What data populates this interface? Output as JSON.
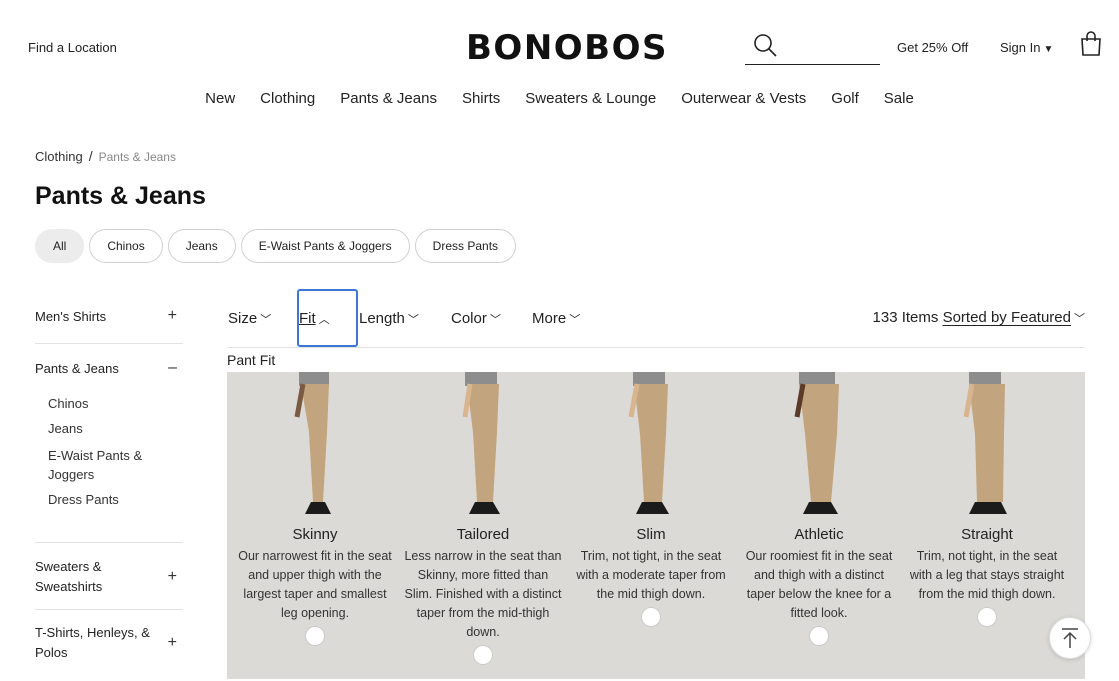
{
  "header": {
    "find_location": "Find a Location",
    "logo": "BONOBOS",
    "search_placeholder": "",
    "promo": "Get 25% Off",
    "sign_in": "Sign In",
    "icons": [
      "search-icon",
      "caret-down-icon",
      "bag-icon"
    ]
  },
  "nav": [
    "New",
    "Clothing",
    "Pants & Jeans",
    "Shirts",
    "Sweaters & Lounge",
    "Outerwear & Vests",
    "Golf",
    "Sale"
  ],
  "breadcrumb": {
    "parent": "Clothing",
    "separator": "/",
    "current": "Pants & Jeans"
  },
  "page_title": "Pants & Jeans",
  "chips": [
    {
      "label": "All",
      "active": true
    },
    {
      "label": "Chinos"
    },
    {
      "label": "Jeans"
    },
    {
      "label": "E-Waist Pants & Joggers"
    },
    {
      "label": "Dress Pants"
    }
  ],
  "sidebar": [
    {
      "label": "Men's Shirts",
      "toggle": "+"
    },
    {
      "label": "Pants & Jeans",
      "toggle": "–",
      "sub": [
        "Chinos",
        "Jeans",
        "E-Waist Pants & Joggers",
        "Dress Pants"
      ]
    },
    {
      "label": "Sweaters & Sweatshirts",
      "toggle": "+"
    },
    {
      "label": "T-Shirts, Henleys, & Polos",
      "toggle": "+"
    }
  ],
  "filters": {
    "size": "Size",
    "fit": "Fit",
    "length": "Length",
    "color": "Color",
    "more": "More",
    "count": "133 Items",
    "sort": "Sorted by Featured"
  },
  "fit_panel": {
    "label": "Pant Fit",
    "colors": {
      "panel_bg": "#dcdad6",
      "pants": "#c2a47e",
      "focus": "#3a77d8"
    },
    "options": [
      {
        "name": "Skinny",
        "desc": "Our narrowest fit in the seat and upper thigh with the largest taper and smallest leg opening."
      },
      {
        "name": "Tailored",
        "desc": "Less narrow in the seat than Skinny, more fitted than Slim. Finished with a distinct taper from the mid-thigh down."
      },
      {
        "name": "Slim",
        "desc": "Trim, not tight, in the seat with a moderate taper from the mid thigh down."
      },
      {
        "name": "Athletic",
        "desc": "Our roomiest fit in the seat and thigh with a distinct taper below the knee for a fitted look."
      },
      {
        "name": "Straight",
        "desc": "Trim, not tight, in the seat with a leg that stays straight from the mid thigh down."
      }
    ]
  }
}
